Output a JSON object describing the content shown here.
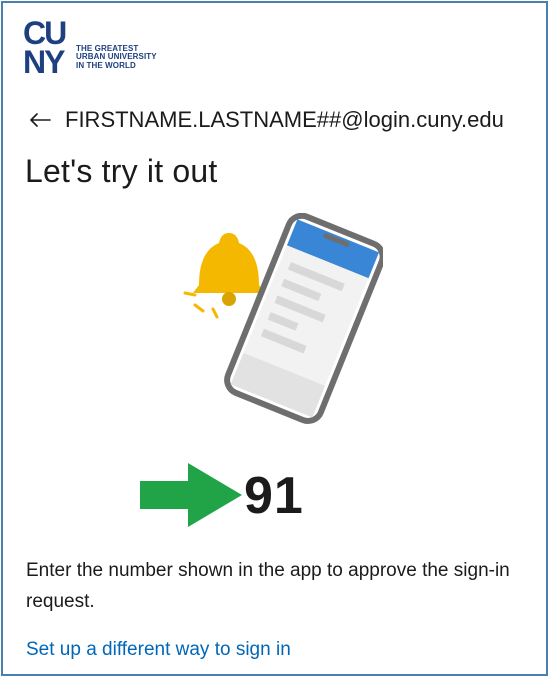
{
  "brand": {
    "logo_letters": "CUNY",
    "tagline_lines": [
      "THE GREATEST",
      "URBAN UNIVERSITY",
      "IN THE WORLD"
    ],
    "color": "#1e3f80"
  },
  "identity": {
    "back_icon": "arrow-left-icon",
    "email": "FIRSTNAME.LASTNAME##@login.cuny.edu"
  },
  "page": {
    "title": "Let's try it out",
    "number_label": "91",
    "instruction": "Enter the number shown in the app to approve the sign-in request.",
    "alternate_link": "Set up a different way to sign in"
  },
  "colors": {
    "accent_link": "#0067b8",
    "frame_border": "#4a7fb0",
    "arrow": "#21a348",
    "bell": "#f5b800",
    "phone_header": "#3a86d6"
  }
}
